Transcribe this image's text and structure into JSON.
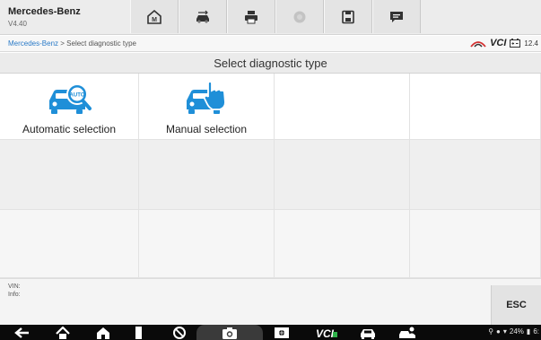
{
  "header": {
    "title": "Mercedes-Benz",
    "version": "V4.40",
    "toolbar": [
      {
        "icon": "home-icon",
        "label": "Home"
      },
      {
        "icon": "vehicle-swap-icon",
        "label": "Vehicle swap"
      },
      {
        "icon": "print-icon",
        "label": "Print"
      },
      {
        "icon": "help-icon",
        "label": "Help"
      },
      {
        "icon": "save-icon",
        "label": "Save"
      },
      {
        "icon": "data-logging-icon",
        "label": "Data logging"
      }
    ]
  },
  "breadcrumb": {
    "link": "Mercedes-Benz",
    "separator": " > ",
    "current": "Select diagnostic type",
    "vci": "VCI",
    "voltage": "12.4"
  },
  "page_title": "Select diagnostic type",
  "tiles": [
    {
      "label": "Automatic selection",
      "icon": "auto-car-search-icon"
    },
    {
      "label": "Manual selection",
      "icon": "manual-car-hand-icon"
    }
  ],
  "footer": {
    "vin_label": "VIN:",
    "info_label": "Info:",
    "esc_label": "ESC"
  },
  "system_status": {
    "battery": "24%",
    "time": "6:"
  },
  "colors": {
    "accent_blue": "#2a7ac7",
    "icon_blue": "#1f8fd8",
    "vci_green": "#2fb24a"
  }
}
